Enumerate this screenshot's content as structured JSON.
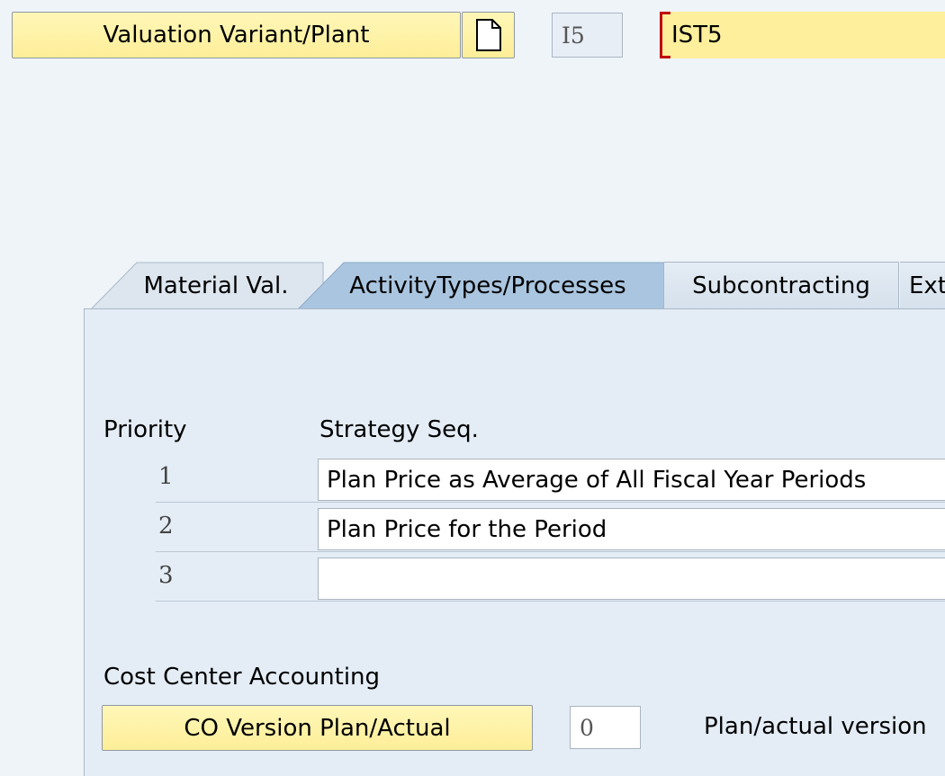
{
  "header": {
    "valuation_button_label": "Valuation Variant/Plant",
    "document_icon": "document-icon",
    "variant_code": "I5",
    "variant_description": "IST5"
  },
  "tabs": [
    {
      "label": "Material Val.",
      "active": false
    },
    {
      "label": "ActivityTypes/Processes",
      "active": true
    },
    {
      "label": "Subcontracting",
      "active": false
    },
    {
      "label": "Ext",
      "active": false
    }
  ],
  "strategy_table": {
    "priority_header": "Priority",
    "strategy_header": "Strategy Seq.",
    "rows": [
      {
        "priority": "1",
        "strategy": "Plan Price as Average of All Fiscal Year Periods"
      },
      {
        "priority": "2",
        "strategy": "Plan Price for the Period"
      },
      {
        "priority": "3",
        "strategy": ""
      }
    ]
  },
  "cost_center": {
    "section_label": "Cost Center Accounting",
    "version_button_label": "CO Version Plan/Actual",
    "version_value": "0",
    "version_description": "Plan/actual version"
  },
  "colors": {
    "button_yellow": "#fdee98",
    "active_tab": "#a3c0dc",
    "required_marker": "#c00000"
  }
}
